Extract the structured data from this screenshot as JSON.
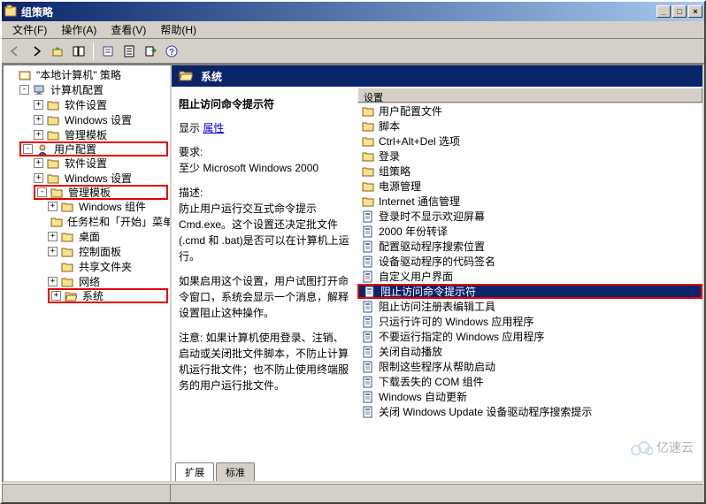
{
  "window": {
    "title": "组策略"
  },
  "menubar": [
    {
      "label": "文件(F)",
      "key": "F"
    },
    {
      "label": "操作(A)",
      "key": "A"
    },
    {
      "label": "查看(V)",
      "key": "V"
    },
    {
      "label": "帮助(H)",
      "key": "H"
    }
  ],
  "toolbar_icons": [
    "back-icon",
    "forward-icon",
    "up-level-icon",
    "show-hide-tree-icon",
    "properties-icon",
    "refresh-icon",
    "export-list-icon",
    "help-icon"
  ],
  "tree": {
    "root": {
      "label": "\"本地计算机\" 策略",
      "icon": "console-root"
    },
    "nodes": [
      {
        "type": "expander-open"
      },
      {
        "label": "计算机配置",
        "icon": "computer-icon",
        "exp": "-",
        "children": [
          {
            "label": "软件设置",
            "icon": "folder",
            "exp": "+"
          },
          {
            "label": "Windows 设置",
            "icon": "folder",
            "exp": "+"
          },
          {
            "label": "管理模板",
            "icon": "folder",
            "exp": "+"
          }
        ]
      },
      {
        "label": "用户配置",
        "icon": "user-icon",
        "exp": "-",
        "highlight": true,
        "children": [
          {
            "label": "软件设置",
            "icon": "folder",
            "exp": "+"
          },
          {
            "label": "Windows 设置",
            "icon": "folder",
            "exp": "+"
          },
          {
            "label": "管理模板",
            "icon": "folder",
            "exp": "-",
            "highlight": true,
            "children": [
              {
                "label": "Windows 组件",
                "icon": "folder",
                "exp": "+"
              },
              {
                "label": "任务栏和「开始」菜单",
                "icon": "folder",
                "exp": ""
              },
              {
                "label": "桌面",
                "icon": "folder",
                "exp": "+"
              },
              {
                "label": "控制面板",
                "icon": "folder",
                "exp": "+"
              },
              {
                "label": "共享文件夹",
                "icon": "folder",
                "exp": ""
              },
              {
                "label": "网络",
                "icon": "folder",
                "exp": "+"
              },
              {
                "label": "系统",
                "icon": "folder-open",
                "exp": "+",
                "highlight": true
              }
            ]
          }
        ]
      }
    ]
  },
  "header": {
    "icon": "folder-open",
    "title": "系统"
  },
  "description": {
    "title": "阻止访问命令提示符",
    "display_label": "显示",
    "properties_link": "属性",
    "req_label": "要求:",
    "req_value": "至少 Microsoft Windows 2000",
    "desc_label": "描述:",
    "desc_body": "防止用户运行交互式命令提示 Cmd.exe。这个设置还决定批文件 (.cmd 和 .bat)是否可以在计算机上运行。",
    "enable_body": "如果启用这个设置，用户试图打开命令窗口，系统会显示一个消息，解释设置阻止这种操作。",
    "note_body": "注意: 如果计算机使用登录、注销、启动或关闭批文件脚本，不防止计算机运行批文件；也不防止使用终端服务的用户运行批文件。"
  },
  "list": {
    "header": "设置",
    "items": [
      {
        "label": "用户配置文件",
        "type": "folder"
      },
      {
        "label": "脚本",
        "type": "folder"
      },
      {
        "label": "Ctrl+Alt+Del 选项",
        "type": "folder"
      },
      {
        "label": "登录",
        "type": "folder"
      },
      {
        "label": "组策略",
        "type": "folder"
      },
      {
        "label": "电源管理",
        "type": "folder"
      },
      {
        "label": "Internet 通信管理",
        "type": "folder"
      },
      {
        "label": "登录时不显示欢迎屏幕",
        "type": "setting"
      },
      {
        "label": "2000 年份转译",
        "type": "setting"
      },
      {
        "label": "配置驱动程序搜索位置",
        "type": "setting"
      },
      {
        "label": "设备驱动程序的代码签名",
        "type": "setting"
      },
      {
        "label": "自定义用户界面",
        "type": "setting"
      },
      {
        "label": "阻止访问命令提示符",
        "type": "setting",
        "selected": true,
        "highlight": true
      },
      {
        "label": "阻止访问注册表编辑工具",
        "type": "setting"
      },
      {
        "label": "只运行许可的 Windows 应用程序",
        "type": "setting"
      },
      {
        "label": "不要运行指定的 Windows 应用程序",
        "type": "setting"
      },
      {
        "label": "关闭自动播放",
        "type": "setting"
      },
      {
        "label": "限制这些程序从帮助启动",
        "type": "setting"
      },
      {
        "label": "下载丢失的 COM 组件",
        "type": "setting"
      },
      {
        "label": "Windows 自动更新",
        "type": "setting"
      },
      {
        "label": "关闭 Windows Update 设备驱动程序搜索提示",
        "type": "setting"
      }
    ]
  },
  "tabs": [
    {
      "label": "扩展",
      "active": true
    },
    {
      "label": "标准"
    }
  ],
  "watermark": "亿速云"
}
